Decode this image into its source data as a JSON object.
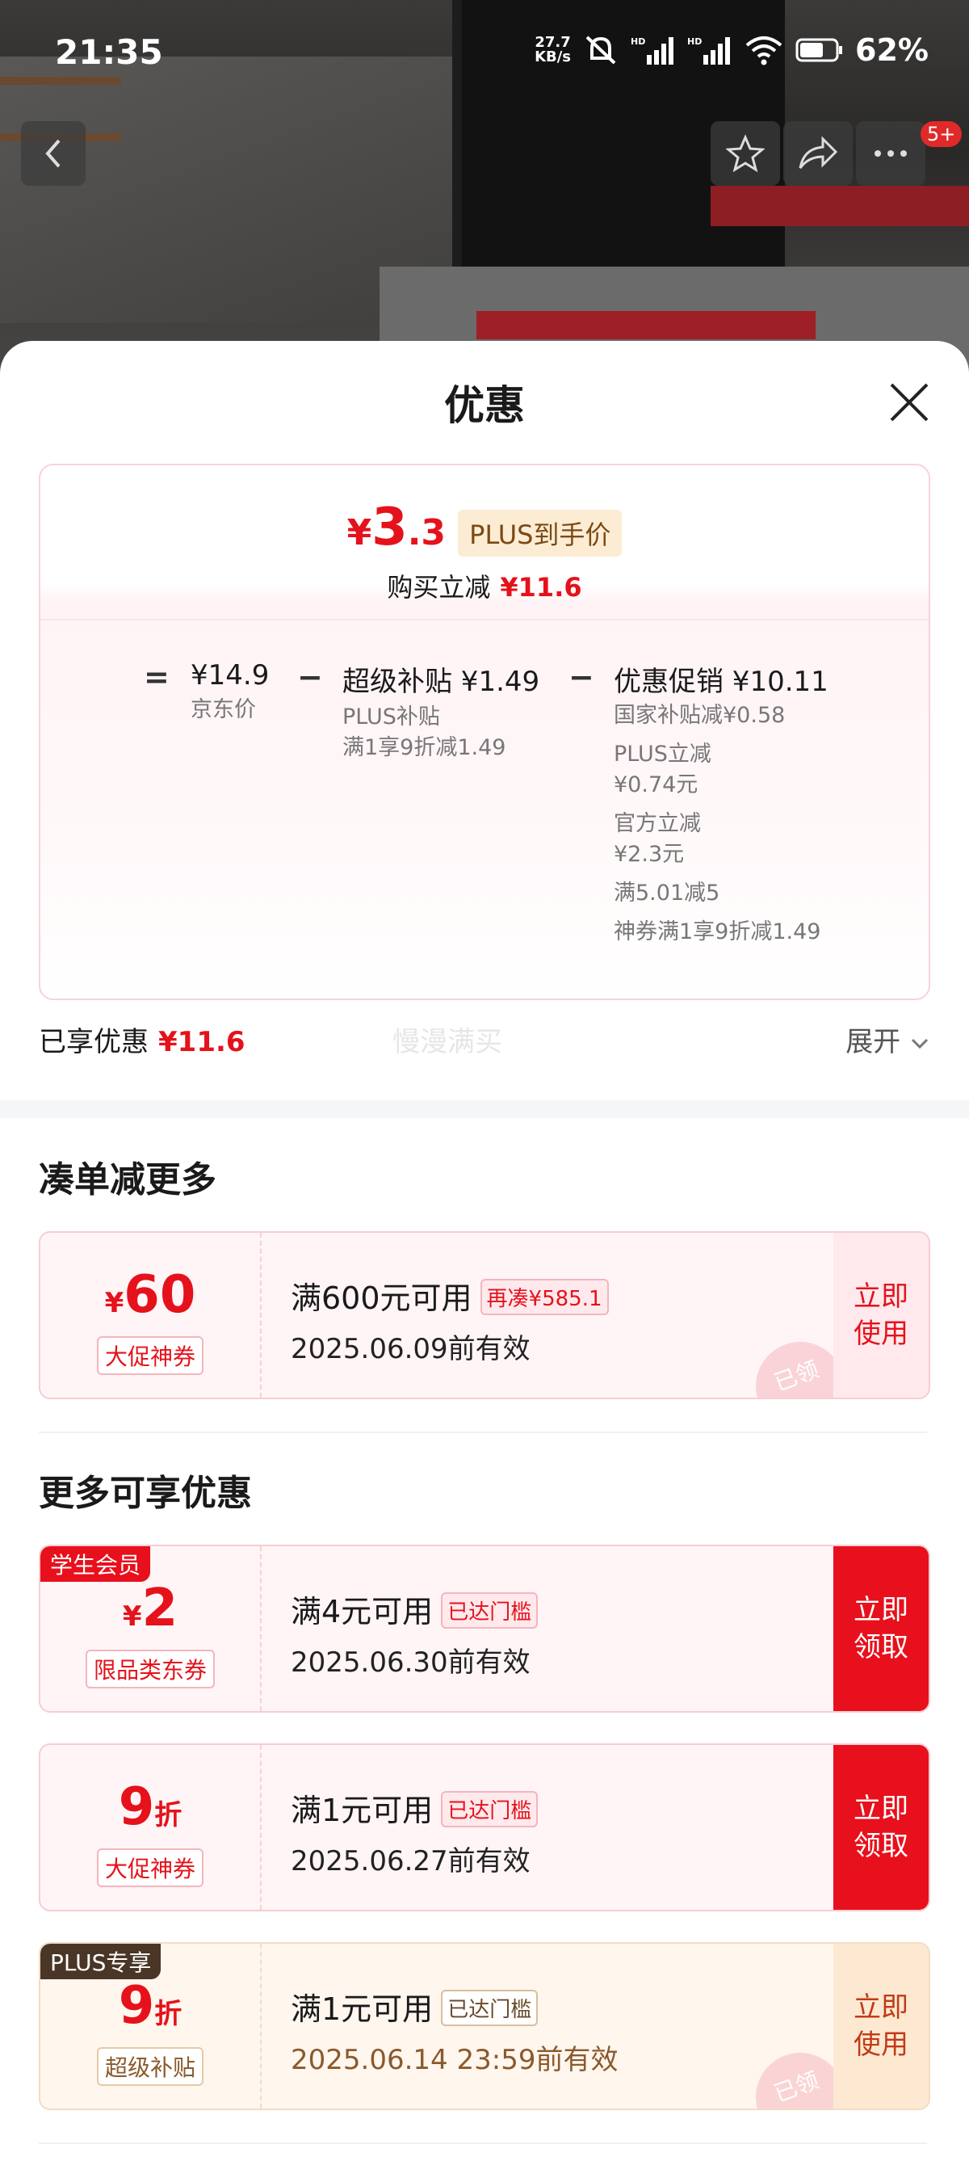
{
  "status": {
    "time": "21:35",
    "net_speed": "27.7",
    "net_unit": "KB/s",
    "battery": "62%"
  },
  "nav": {
    "badge": "5+"
  },
  "sheet": {
    "title": "优惠",
    "price": {
      "yen": "¥",
      "int": "3",
      "dec": ".3",
      "tag": "PLUS到手价",
      "reduce_label": "购买立减",
      "reduce_value": "¥11.6"
    },
    "breakdown": {
      "eq": "=",
      "jd_price": "¥14.9",
      "jd_label": "京东价",
      "minus1": "−",
      "subsidy_title": "超级补贴 ¥1.49",
      "subsidy_line1": "PLUS补贴",
      "subsidy_line2": "满1享9折减1.49",
      "minus2": "−",
      "promo_title": "优惠促销 ¥10.11",
      "promo_items": [
        "国家补贴减¥0.58",
        "PLUS立减\n¥0.74元",
        "官方立减\n¥2.3元",
        "满5.01减5",
        "神券满1享9折减1.49"
      ]
    },
    "enjoyed_label": "已享优惠",
    "enjoyed_value": "¥11.6",
    "ghost_text": "慢漫满买",
    "expand": "展开"
  },
  "section1": {
    "title": "凑单减更多"
  },
  "section2": {
    "title": "更多可享优惠"
  },
  "coupons": [
    {
      "yen": "¥",
      "amount": "60",
      "unit": "",
      "kind": "大促神券",
      "cond": "满600元可用",
      "chip": "再凑¥585.1",
      "date": "2025.06.09前有效",
      "action": "立即\n使用",
      "stamp": "已领",
      "corner": ""
    },
    {
      "yen": "¥",
      "amount": "2",
      "unit": "",
      "kind": "限品类东券",
      "cond": "满4元可用",
      "chip": "已达门槛",
      "date": "2025.06.30前有效",
      "action": "立即\n领取",
      "stamp": "",
      "corner": "学生会员"
    },
    {
      "yen": "",
      "amount": "9",
      "unit": "折",
      "kind": "大促神券",
      "cond": "满1元可用",
      "chip": "已达门槛",
      "date": "2025.06.27前有效",
      "action": "立即\n领取",
      "stamp": "",
      "corner": ""
    },
    {
      "yen": "",
      "amount": "9",
      "unit": "折",
      "kind": "超级补贴",
      "cond": "满1元可用",
      "chip": "已达门槛",
      "date": "2025.06.14 23:59前有效",
      "action": "立即\n使用",
      "stamp": "已领",
      "corner": "PLUS专享"
    }
  ],
  "colors": {
    "accent": "#e5121b",
    "plus_gold": "#fcecd4"
  }
}
